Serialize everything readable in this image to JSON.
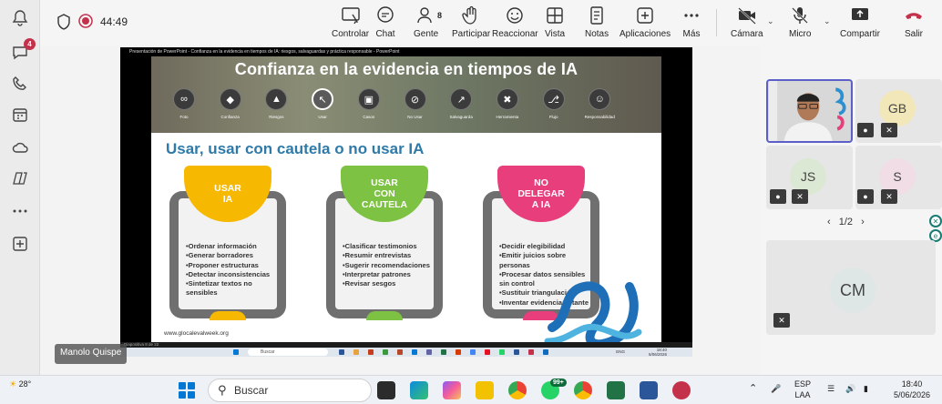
{
  "rail": {
    "chat_badge": "4"
  },
  "meeting": {
    "timer": "44:49",
    "people_count": "8",
    "buttons": {
      "control": "Controlar",
      "chat": "Chat",
      "people": "Gente",
      "raise": "Participar",
      "react": "Reaccionar",
      "view": "Vista",
      "notes": "Notas",
      "apps": "Aplicaciones",
      "more": "Más",
      "camera": "Cámara",
      "mic": "Micro",
      "share": "Compartir",
      "leave": "Salir"
    }
  },
  "presentation": {
    "window_title": "Presentación de PowerPoint - Confianza en la evidencia en tiempos de IA: riesgos, salvaguardas y práctica responsable - PowerPoint",
    "slide_title": "Confianza en la evidencia en tiempos de IA",
    "nav": [
      {
        "label": "Foto",
        "icon": "link-icon"
      },
      {
        "label": "Confianza",
        "icon": "shield-icon"
      },
      {
        "label": "Riesgos",
        "icon": "warning-icon"
      },
      {
        "label": "Usar",
        "icon": "cursor-icon"
      },
      {
        "label": "Casos",
        "icon": "briefcase-icon"
      },
      {
        "label": "No Usar",
        "icon": "ban-icon"
      },
      {
        "label": "Salvaguarda",
        "icon": "chart-icon"
      },
      {
        "label": "Herramienta",
        "icon": "tools-icon"
      },
      {
        "label": "Flujo",
        "icon": "flow-icon"
      },
      {
        "label": "Responsabilidad",
        "icon": "person-check-icon"
      }
    ],
    "subtitle": "Usar, usar con cautela o no usar IA",
    "cards": [
      {
        "heading": [
          "USAR",
          "IA"
        ],
        "color": "#f6b800",
        "items": [
          "Ordenar información",
          "Generar borradores",
          "Proponer estructuras",
          "Detectar inconsistencias",
          "Sintetizar textos no sensibles"
        ]
      },
      {
        "heading": [
          "USAR",
          "CON",
          "CAUTELA"
        ],
        "color": "#7dc242",
        "items": [
          "Clasificar testimonios",
          "Resumir entrevistas",
          "Sugerir recomendaciones",
          "Interpretar patrones",
          "Revisar sesgos"
        ]
      },
      {
        "heading": [
          "NO",
          "DELEGAR",
          "A IA"
        ],
        "color": "#e83e7c",
        "items": [
          "Decidir elegibilidad",
          "Emitir juicios sobre personas",
          "Procesar datos sensibles sin control",
          "Sustituir triangulación",
          "Inventar evidencia faltante"
        ]
      }
    ],
    "url": "www.glocalevalweek.org",
    "status_bar": "Diapositiva 8 de 22",
    "inner_search": "Buscar",
    "inner_clock": [
      "18:40",
      "5/06/2026"
    ],
    "inner_lang": "ENG"
  },
  "presenter_name": "Manolo Quispe",
  "participants": [
    {
      "initials": "GB"
    },
    {
      "initials": "JS"
    },
    {
      "initials": "S"
    },
    {
      "initials": "CM"
    }
  ],
  "pager": "1/2",
  "taskbar": {
    "temperature": "28°",
    "search": "Buscar",
    "whatsapp_badge": "99+",
    "lang": [
      "ESP",
      "LAA"
    ],
    "time": "18:40",
    "date": "5/06/2026"
  },
  "colors": {
    "accent": "#5b5fc7",
    "leave": "#c4314b",
    "slide_subtitle": "#2e7aa8"
  }
}
